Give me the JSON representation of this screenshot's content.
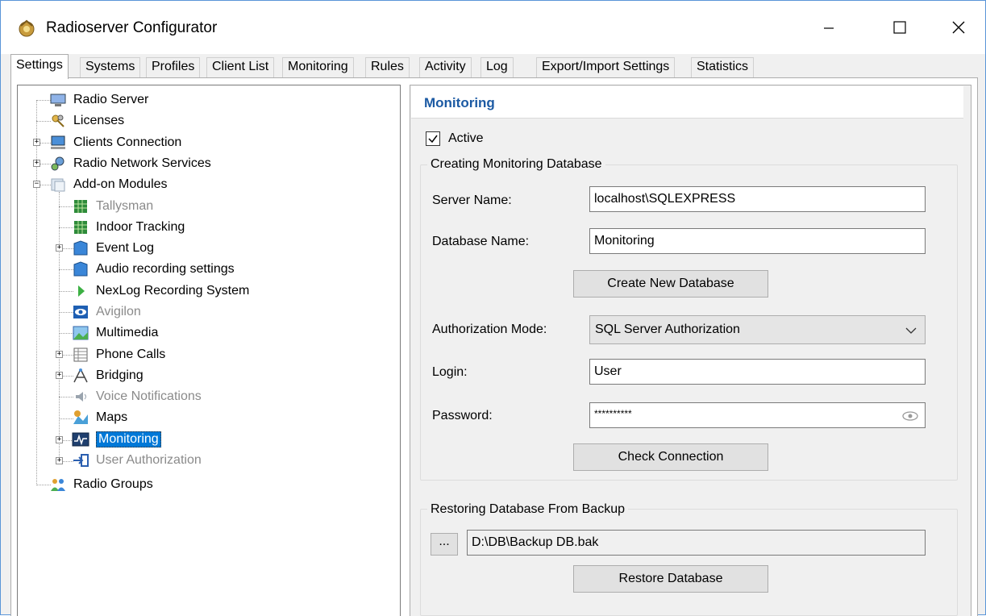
{
  "window": {
    "title": "Radioserver Configurator",
    "icons": {
      "app": "radioserver-app-icon",
      "minimize": "minimize-icon",
      "maximize": "maximize-icon",
      "close": "close-icon"
    }
  },
  "tabs": [
    {
      "label": "Settings",
      "active": true
    },
    {
      "label": "Systems"
    },
    {
      "label": "Profiles"
    },
    {
      "label": "Client List"
    },
    {
      "label": "Monitoring"
    },
    {
      "label": "Rules"
    },
    {
      "label": "Activity"
    },
    {
      "label": "Log"
    },
    {
      "label": "Export/Import Settings"
    },
    {
      "label": "Statistics"
    }
  ],
  "tree": {
    "items": [
      {
        "label": "Radio Server",
        "icon": "server-icon"
      },
      {
        "label": "Licenses",
        "icon": "keys-icon"
      },
      {
        "label": "Clients Connection",
        "icon": "network-computer-icon"
      },
      {
        "label": "Radio Network Services",
        "icon": "gears-icon"
      },
      {
        "label": "Add-on Modules",
        "icon": "modules-icon"
      },
      {
        "label": "Tallysman",
        "icon": "grid-green-icon",
        "disabled": true
      },
      {
        "label": "Indoor Tracking",
        "icon": "grid-green-icon"
      },
      {
        "label": "Event Log",
        "icon": "log-book-icon"
      },
      {
        "label": "Audio recording settings",
        "icon": "audio-book-icon"
      },
      {
        "label": "NexLog Recording System",
        "icon": "green-arrow-icon"
      },
      {
        "label": "Avigilon",
        "icon": "eye-icon",
        "disabled": true
      },
      {
        "label": "Multimedia",
        "icon": "picture-icon"
      },
      {
        "label": "Phone Calls",
        "icon": "phone-table-icon"
      },
      {
        "label": "Bridging",
        "icon": "bridging-icon"
      },
      {
        "label": "Voice Notifications",
        "icon": "speaker-icon",
        "disabled": true
      },
      {
        "label": "Maps",
        "icon": "map-icon"
      },
      {
        "label": "Monitoring",
        "icon": "monitor-chart-icon",
        "selected": true
      },
      {
        "label": "User Authorization",
        "icon": "login-arrow-icon",
        "disabled": true
      },
      {
        "label": "Radio Groups",
        "icon": "users-group-icon"
      }
    ]
  },
  "panel": {
    "title": "Monitoring",
    "active_label": "Active",
    "active_checked": true,
    "create_group": {
      "legend": "Creating Monitoring Database",
      "server_name_label": "Server Name:",
      "server_name_value": "localhost\\SQLEXPRESS",
      "database_name_label": "Database Name:",
      "database_name_value": "Monitoring",
      "create_button": "Create New Database",
      "auth_mode_label": "Authorization Mode:",
      "auth_mode_value": "SQL Server Authorization",
      "login_label": "Login:",
      "login_value": "User",
      "password_label": "Password:",
      "password_value": "**********",
      "check_button": "Check Connection"
    },
    "restore_group": {
      "legend": "Restoring Database From Backup",
      "browse_button": "...",
      "backup_path": "D:\\DB\\Backup DB.bak",
      "restore_button": "Restore Database"
    }
  }
}
